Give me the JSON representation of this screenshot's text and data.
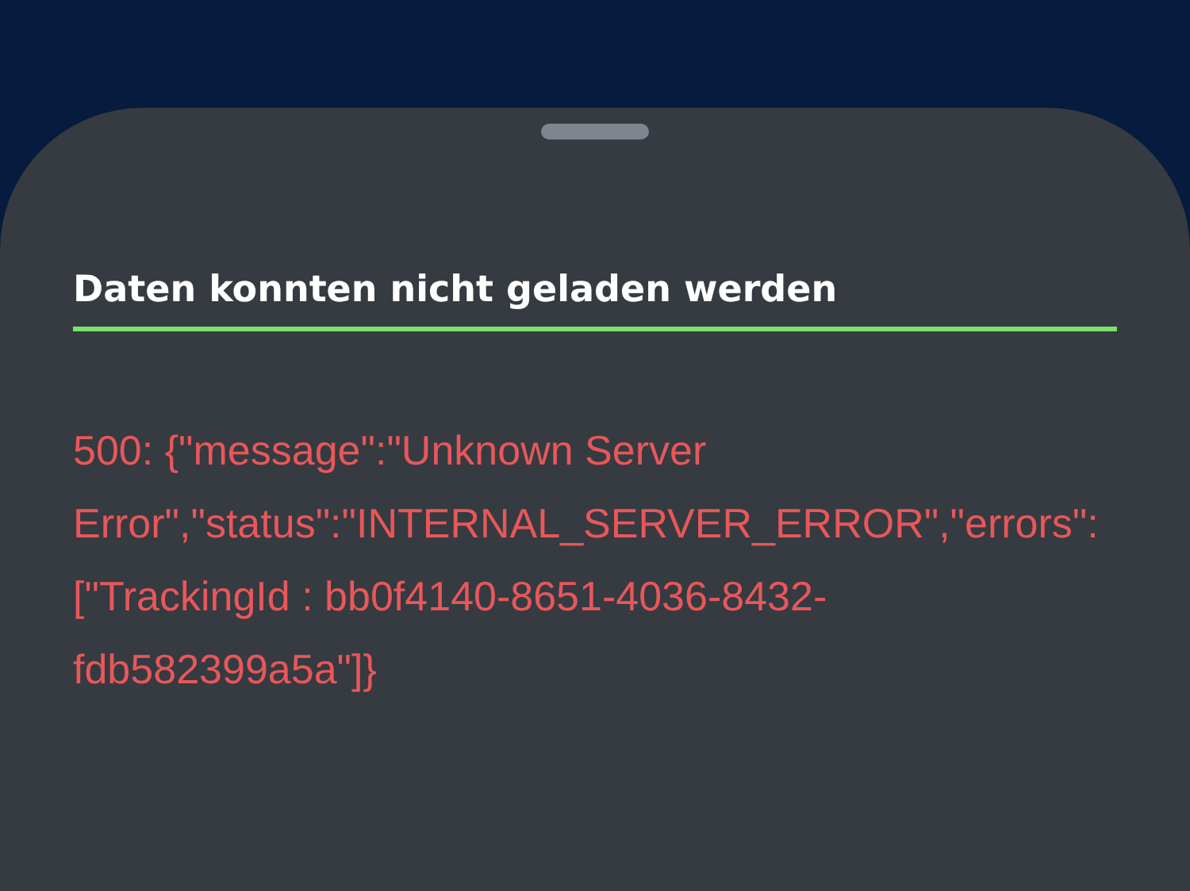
{
  "sheet": {
    "title": "Daten konnten nicht geladen werden",
    "message": "500: {\"message\":\"Unknown Server Error\",\"status\":\"INTERNAL_SERVER_ERROR\",\"errors\":[\"TrackingId : bb0f4140-8651-4036-8432-fdb582399a5a\"]}"
  }
}
